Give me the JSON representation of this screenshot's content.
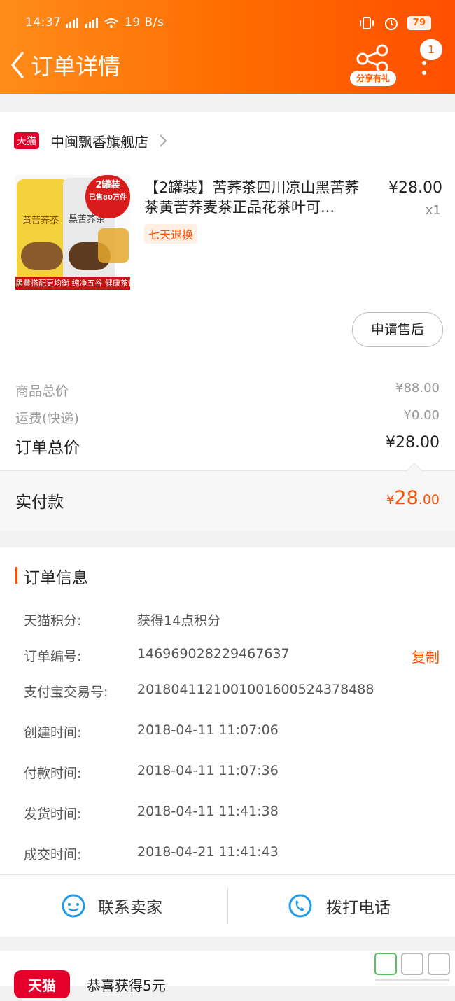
{
  "status_bar": {
    "time": "14:37",
    "network": "19 B/s",
    "battery": "79"
  },
  "header": {
    "title": "订单详情",
    "share_label": "分享有礼",
    "badge_count": "1",
    "gradient": [
      "#ff8c1a",
      "#ff4f00"
    ]
  },
  "shop": {
    "platform_tag": "天猫",
    "name": "中闽飘香旗舰店"
  },
  "product": {
    "title": "【2罐装】苦荞茶四川凉山黑苦荞茶黄苦荞麦茶正品花茶叶可...",
    "price": "¥28.00",
    "quantity": "x1",
    "tag": "七天退换",
    "image_texts": {
      "badge": "2罐装",
      "badge_sub": "已售80万件",
      "can_left": "黄苦荞茶",
      "can_right": "黑苦荞茶",
      "strip": "黑黄搭配更均衡  纯净五谷 健康茶饮"
    }
  },
  "after_sale_button": "申请售后",
  "fees": [
    {
      "label": "商品总价",
      "value": "¥88.00"
    },
    {
      "label": "运费(快递)",
      "value": "¥0.00"
    },
    {
      "label": "订单总价",
      "value": "¥28.00"
    }
  ],
  "paid": {
    "label": "实付款",
    "symbol": "¥",
    "integer": "28",
    "decimal": ".00"
  },
  "order_info": {
    "title": "订单信息",
    "copy_label": "复制",
    "rows": [
      {
        "key": "天猫积分:",
        "value": "获得14点积分"
      },
      {
        "key": "订单编号:",
        "value": "146969028229467637"
      },
      {
        "key": "支付宝交易号:",
        "value": "2018041121001001600524378488"
      },
      {
        "key": "创建时间:",
        "value": "2018-04-11 11:07:06"
      },
      {
        "key": "付款时间:",
        "value": "2018-04-11 11:07:36"
      },
      {
        "key": "发货时间:",
        "value": "2018-04-11 11:41:38"
      },
      {
        "key": "成交时间:",
        "value": "2018-04-21 11:41:43"
      }
    ]
  },
  "actions": {
    "contact_seller": "联系卖家",
    "call": "拨打电话"
  },
  "reward": {
    "logo": "天猫",
    "text": "恭喜获得5元"
  },
  "accent_color": "#ff5000"
}
